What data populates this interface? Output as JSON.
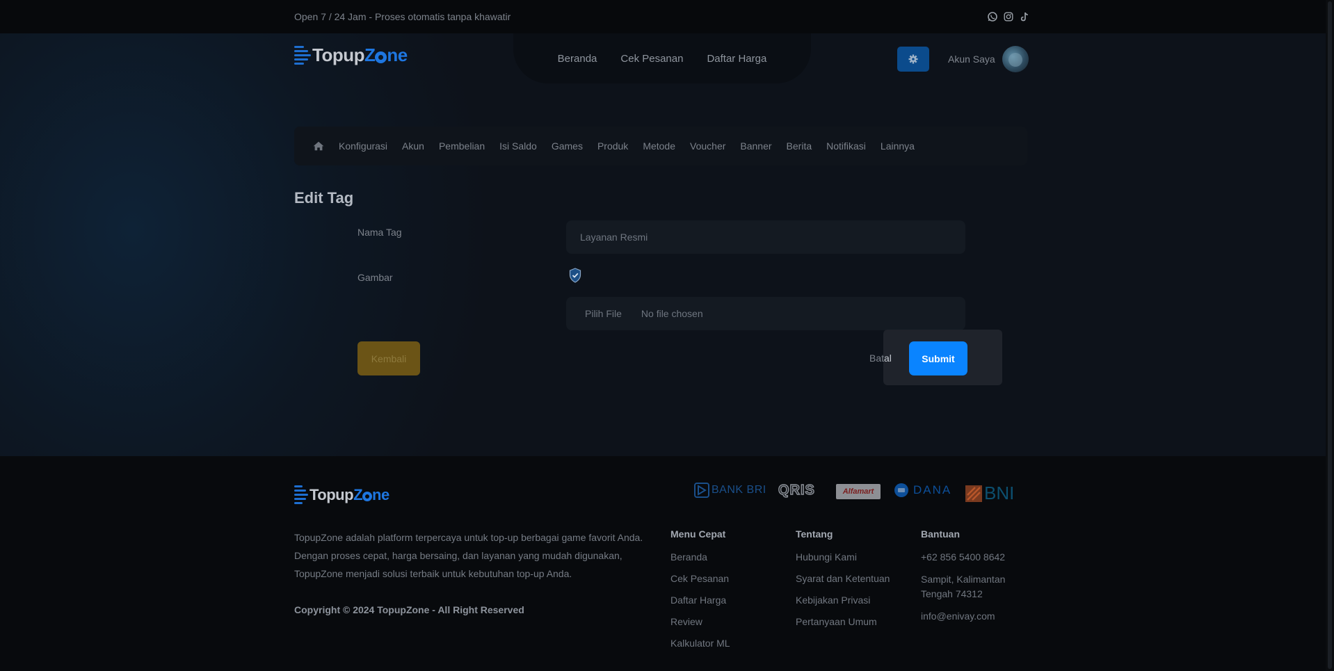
{
  "topbar": {
    "tagline": "Open 7 / 24 Jam - Proses otomatis tanpa khawatir",
    "socials": [
      "whatsapp-icon",
      "instagram-icon",
      "tiktok-icon"
    ]
  },
  "header": {
    "logo": {
      "part1": "Topup",
      "part2a": "Z",
      "part2b": "ne"
    },
    "nav": [
      "Beranda",
      "Cek Pesanan",
      "Daftar Harga"
    ],
    "account_label": "Akun Saya"
  },
  "admin_menu": {
    "items": [
      "Konfigurasi",
      "Akun",
      "Pembelian",
      "Isi Saldo",
      "Games",
      "Produk",
      "Metode",
      "Voucher",
      "Banner",
      "Berita",
      "Notifikasi",
      "Lainnya"
    ]
  },
  "form": {
    "title": "Edit Tag",
    "name_label": "Nama Tag",
    "name_value": "Layanan Resmi",
    "image_label": "Gambar",
    "file_button": "Pilih File",
    "file_status": "No file chosen",
    "back_label": "Kembali",
    "cancel_label_a": "Bat",
    "cancel_label_b": "al",
    "submit_label": "Submit"
  },
  "footer": {
    "payments": [
      "BANK BRI",
      "QRIS",
      "Alfamart",
      "DANA",
      "BNI"
    ],
    "about": "TopupZone adalah platform terpercaya untuk top-up berbagai game favorit Anda. Dengan proses cepat, harga bersaing, dan layanan yang mudah digunakan, TopupZone menjadi solusi terbaik untuk kebutuhan top-up Anda.",
    "copyright": "Copyright © 2024 TopupZone - All Right Reserved",
    "menu_cepat": {
      "title": "Menu Cepat",
      "links": [
        "Beranda",
        "Cek Pesanan",
        "Daftar Harga",
        "Review",
        "Kalkulator ML"
      ]
    },
    "tentang": {
      "title": "Tentang",
      "links": [
        "Hubungi Kami",
        "Syarat dan Ketentuan",
        "Kebijakan Privasi",
        "Pertanyaan Umum"
      ]
    },
    "bantuan": {
      "title": "Bantuan",
      "links": [
        "+62 856 5400 8642",
        "Sampit, Kalimantan Tengah 74312",
        "info@enivay.com"
      ]
    }
  },
  "colors": {
    "accent": "#0a84ff",
    "back_button": "#6b5416",
    "logo_blue": "#1e76e0"
  }
}
